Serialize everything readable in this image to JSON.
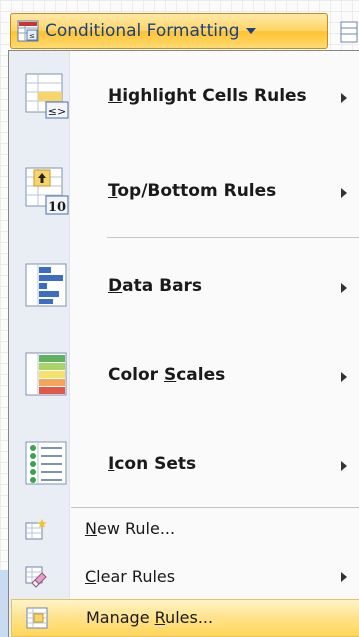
{
  "ribbon": {
    "button_label": "Conditional Formatting",
    "icon": "conditional-formatting-icon"
  },
  "menu": {
    "items": [
      {
        "label_pre": "",
        "label_key": "H",
        "label_post": "ighlight Cells Rules",
        "icon": "highlight-cells-icon",
        "submenu": true
      },
      {
        "label_pre": "",
        "label_key": "T",
        "label_post": "op/Bottom Rules",
        "icon": "top-bottom-icon",
        "submenu": true
      },
      {
        "label_pre": "",
        "label_key": "D",
        "label_post": "ata Bars",
        "icon": "data-bars-icon",
        "submenu": true
      },
      {
        "label_pre": "Color ",
        "label_key": "S",
        "label_post": "cales",
        "icon": "color-scales-icon",
        "submenu": true
      },
      {
        "label_pre": "",
        "label_key": "I",
        "label_post": "con Sets",
        "icon": "icon-sets-icon",
        "submenu": true
      },
      {
        "label_pre": "",
        "label_key": "N",
        "label_post": "ew Rule...",
        "icon": "new-rule-icon",
        "submenu": false
      },
      {
        "label_pre": "",
        "label_key": "C",
        "label_post": "lear Rules",
        "icon": "clear-rules-icon",
        "submenu": true
      },
      {
        "label_pre": "Manage ",
        "label_key": "R",
        "label_post": "ules...",
        "icon": "manage-rules-icon",
        "submenu": false
      }
    ],
    "icon_text": {
      "highlight_symbol": "≤>",
      "top_number": "10"
    }
  }
}
